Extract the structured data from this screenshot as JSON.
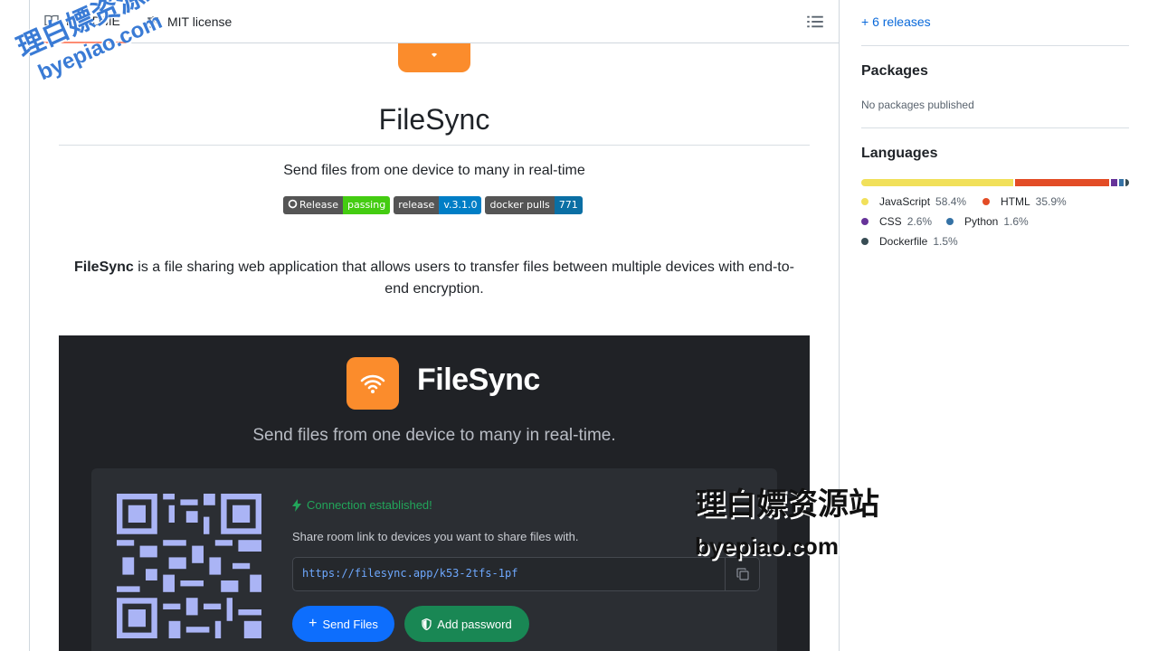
{
  "tabs": {
    "readme": "README",
    "license": "MIT license"
  },
  "readme": {
    "title": "FileSync",
    "tagline": "Send files from one device to many in real-time",
    "badges": [
      {
        "left": "Release",
        "right": "passing",
        "color": "#4c1"
      },
      {
        "left": "release",
        "right": "v.3.1.0",
        "color": "#007ec6"
      },
      {
        "left": "docker pulls",
        "right": "771",
        "color": "#0b6fa4"
      }
    ],
    "description_bold": "FileSync",
    "description_rest": " is a file sharing web application that allows users to transfer files between multiple devices with end-to-end encryption."
  },
  "screenshot": {
    "title": "FileSync",
    "subtitle": "Send files from one device to many in real-time.",
    "connection": "Connection established!",
    "share_text": "Share room link to devices you want to share files with.",
    "link": "https://filesync.app/k53-2tfs-1pf",
    "send_button": "Send Files",
    "password_button": "Add password"
  },
  "sidebar": {
    "releases": "+ 6 releases",
    "packages_title": "Packages",
    "packages_text": "No packages published",
    "languages_title": "Languages",
    "languages": [
      {
        "name": "JavaScript",
        "pct": "58.4%",
        "color": "#f1e05a",
        "value": 58.4
      },
      {
        "name": "HTML",
        "pct": "35.9%",
        "color": "#e34c26",
        "value": 35.9
      },
      {
        "name": "CSS",
        "pct": "2.6%",
        "color": "#663399",
        "value": 2.6
      },
      {
        "name": "Python",
        "pct": "1.6%",
        "color": "#3572A5",
        "value": 1.6
      },
      {
        "name": "Dockerfile",
        "pct": "1.5%",
        "color": "#384d54",
        "value": 1.5
      }
    ]
  },
  "watermark": {
    "cn": "理白嫖资源站",
    "url": "byepiao.com"
  }
}
